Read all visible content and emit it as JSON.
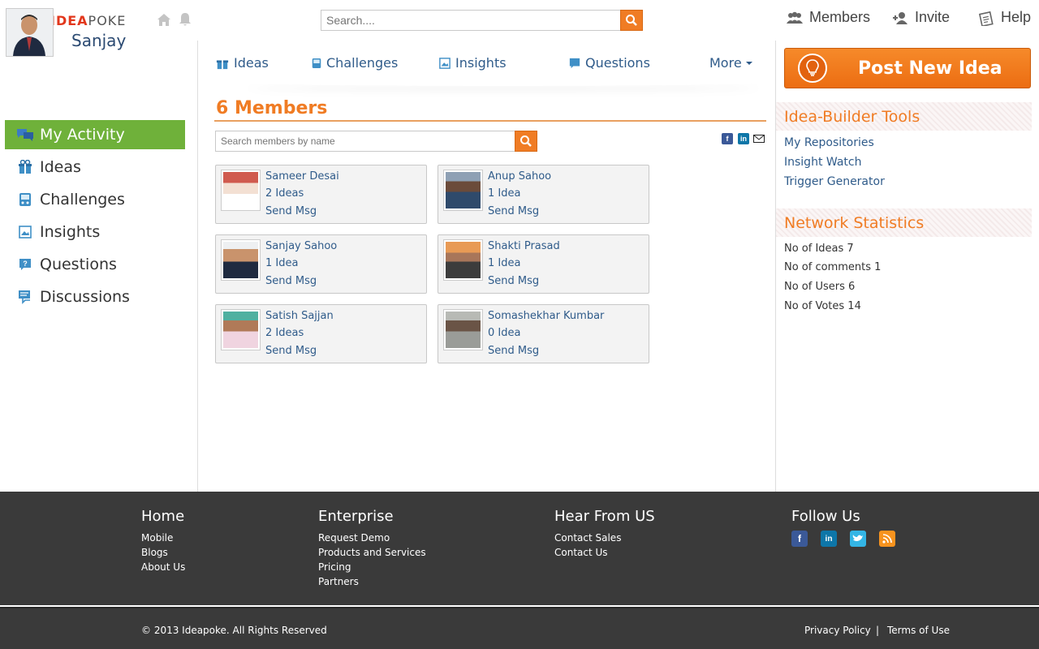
{
  "app": {
    "logo_text_left": "IDEA",
    "logo_text_right": "POKE",
    "search_placeholder": "Search...."
  },
  "top_nav": {
    "members": "Members",
    "invite": "Invite",
    "help": "Help"
  },
  "user": {
    "name": "Sanjay"
  },
  "sidebar": {
    "items": [
      {
        "label": "My Activity",
        "icon": "chat-icon",
        "active": true
      },
      {
        "label": "Ideas",
        "icon": "gift-icon"
      },
      {
        "label": "Challenges",
        "icon": "gamepad-icon"
      },
      {
        "label": "Insights",
        "icon": "image-icon"
      },
      {
        "label": "Questions",
        "icon": "question-icon"
      },
      {
        "label": "Discussions",
        "icon": "discussion-icon"
      }
    ]
  },
  "tabs": {
    "ideas": "Ideas",
    "challenges": "Challenges",
    "insights": "Insights",
    "questions": "Questions",
    "more": "More"
  },
  "members": {
    "title": "6 Members",
    "search_placeholder": "Search members by name",
    "list": [
      {
        "name": "Sameer Desai",
        "ideas": "2 Ideas",
        "msg": "Send Msg",
        "photo_color": "#c9453f"
      },
      {
        "name": "Anup Sahoo",
        "ideas": "1 Idea",
        "msg": "Send Msg",
        "photo_color": "#556b84"
      },
      {
        "name": "Sanjay Sahoo",
        "ideas": "1 Idea",
        "msg": "Send Msg",
        "photo_color": "#2e3a58"
      },
      {
        "name": "Shakti Prasad",
        "ideas": "1 Idea",
        "msg": "Send Msg",
        "photo_color": "#d98a4a"
      },
      {
        "name": "Satish Sajjan",
        "ideas": "2 Ideas",
        "msg": "Send Msg",
        "photo_color": "#3f9a8e"
      },
      {
        "name": "Somashekhar Kumbar",
        "ideas": "0 Idea",
        "msg": "Send Msg",
        "photo_color": "#8d8f8a"
      }
    ]
  },
  "right": {
    "post_button": "Post New Idea",
    "tools_title": "Idea-Builder Tools",
    "tools": [
      "My Repositories",
      "Insight Watch",
      "Trigger Generator"
    ],
    "stats_title": "Network Statistics",
    "stats": [
      "No of Ideas 7",
      "No of comments 1",
      "No of Users 6",
      "No of Votes 14"
    ]
  },
  "footer": {
    "home": {
      "title": "Home",
      "links": [
        "Mobile",
        "Blogs",
        "About Us"
      ]
    },
    "enterprise": {
      "title": "Enterprise",
      "links": [
        "Request Demo",
        "Products and Services",
        "Pricing",
        "Partners"
      ]
    },
    "hear": {
      "title": "Hear From US",
      "links": [
        "Contact Sales",
        "Contact Us"
      ]
    },
    "follow": {
      "title": "Follow Us"
    },
    "copyright": "© 2013 Ideapoke. All Rights Reserved",
    "privacy": "Privacy Policy",
    "separator": "|",
    "terms": "Terms of Use"
  },
  "colors": {
    "accent": "#f07c24",
    "active_green": "#6fb13a",
    "link_blue": "#2f5b8a",
    "footer_bg": "#3a3a3a"
  }
}
